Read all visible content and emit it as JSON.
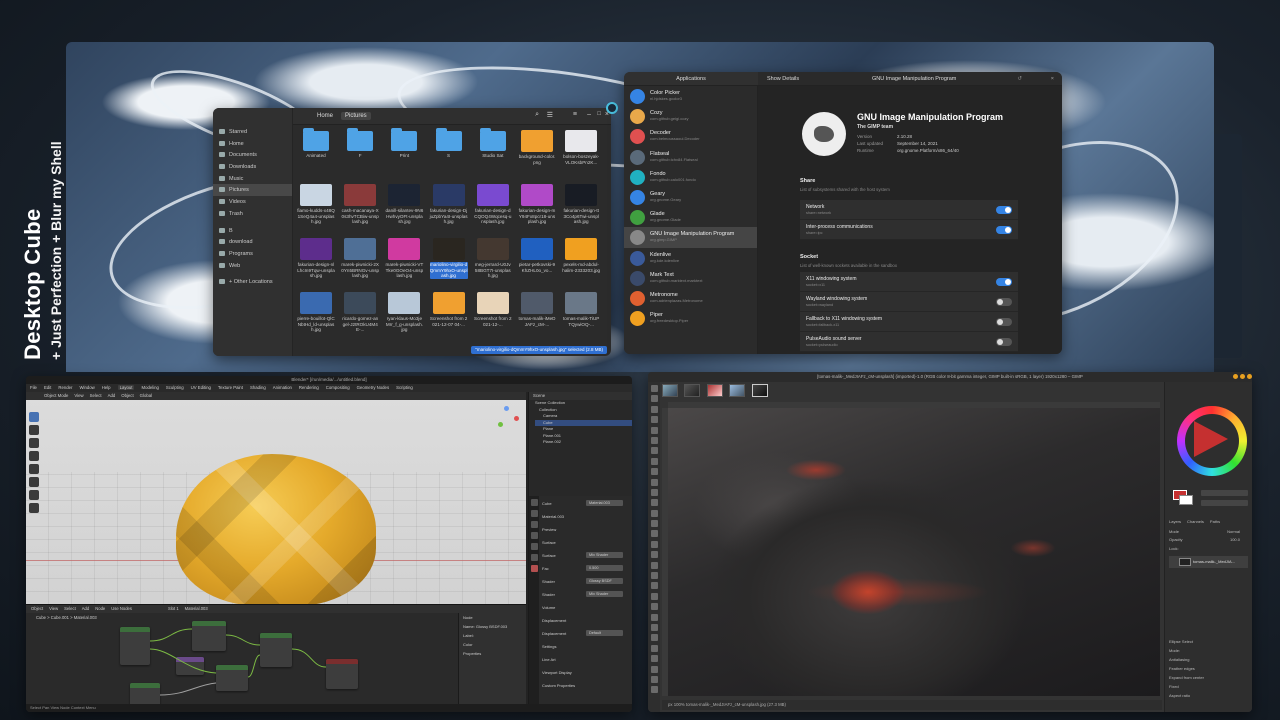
{
  "overlay": {
    "title": "Desktop Cube",
    "subtitle": "+ Just Perfection + Blur my Shell"
  },
  "files": {
    "sidebar": [
      {
        "label": "Starred",
        "active": false
      },
      {
        "label": "Home",
        "active": false
      },
      {
        "label": "Documents",
        "active": false
      },
      {
        "label": "Downloads",
        "active": false
      },
      {
        "label": "Music",
        "active": false
      },
      {
        "label": "Pictures",
        "active": true
      },
      {
        "label": "Videos",
        "active": false
      },
      {
        "label": "Trash",
        "active": false
      },
      {
        "label": "B",
        "active": false
      },
      {
        "label": "download",
        "active": false
      },
      {
        "label": "Programs",
        "active": false
      },
      {
        "label": "Web",
        "active": false
      },
      {
        "label": "+ Other Locations",
        "active": false
      }
    ],
    "path_home": "Home",
    "path_current": "Pictures",
    "items": [
      {
        "name": "Animated",
        "kind": "folder",
        "color": "#4fa3e6"
      },
      {
        "name": "F",
        "kind": "folder",
        "color": "#4fa3e6"
      },
      {
        "name": "Print",
        "kind": "folder",
        "color": "#4fa3e6"
      },
      {
        "name": "S",
        "kind": "folder",
        "color": "#4fa3e6"
      },
      {
        "name": "Studio Sat",
        "kind": "folder",
        "color": "#4fa3e6"
      },
      {
        "name": "background-color.png",
        "kind": "image",
        "color": "#f0a030"
      },
      {
        "name": "bolson-boszeyak-VLOKsbPn2K...",
        "kind": "image",
        "color": "#e8e8ec"
      },
      {
        "name": "fiamo-kudds-x48Q1SeQ4a4-unsplash.jpg",
        "kind": "image",
        "color": "#c9d6e3"
      },
      {
        "name": "cash-macanaya-X0s3hvTCBiw-unsplash.jpg",
        "kind": "image",
        "color": "#8a3a3a"
      },
      {
        "name": "danill-silantev-9N6HwhvyOFt-unsplash.jpg",
        "kind": "image",
        "color": "#1c2433"
      },
      {
        "name": "fakurian-design-DjjuZpbYa4I-unsplash.jpg",
        "kind": "image",
        "color": "#2a3a66"
      },
      {
        "name": "fakurian-design-dCQOQ4Wqcesq-unsplash.jpg",
        "kind": "image",
        "color": "#7a4ad0"
      },
      {
        "name": "fakurian-design-mY94Fx8pcr18-unsplash.jpg",
        "kind": "image",
        "color": "#b04ac8"
      },
      {
        "name": "fakurian-design-tt3Co4p6Twi-unsplash.jpg",
        "kind": "image",
        "color": "#181c24"
      },
      {
        "name": "fakurian-design-nlLhcIn9Tqw-unsplash.jpg",
        "kind": "image",
        "color": "#5d2d8c"
      },
      {
        "name": "marek-piwnicki-2X0Yn5BRNGv-unsplash.jpg",
        "kind": "image",
        "color": "#4f6f96"
      },
      {
        "name": "marek-piwnicki-VTTke0GOeO4-unsplash.jpg",
        "kind": "image",
        "color": "#d03aa0"
      },
      {
        "name": "mariolino-virgilio-dQmmY9hxO-unsplash.jpg",
        "kind": "image",
        "color": "#2a2620"
      },
      {
        "name": "meg-jerrard-U0Jv58BGT7I-unsplash.jpg",
        "kind": "image",
        "color": "#443830"
      },
      {
        "name": "pietar-petkovski-9KhZHL0o_vo...",
        "kind": "image",
        "color": "#2060c0"
      },
      {
        "name": "pexels-md-abdul-halim-2333203.jpg",
        "kind": "image",
        "color": "#f0a020"
      },
      {
        "name": "pierre-bouillot-QlCNbtHd_ld-unsplash.jpg",
        "kind": "image",
        "color": "#3a6ab0"
      },
      {
        "name": "ricardo-gomez-angel-J2tROkU4M4E-...",
        "kind": "image",
        "color": "#3c4a5a"
      },
      {
        "name": "ryan-klaus-Mo3jeMrr_f_g-unsplash.jpg",
        "kind": "image",
        "color": "#b8c8d8"
      },
      {
        "name": "Screenshot from 2021-12-07 04-...",
        "kind": "image",
        "color": "#f0a030"
      },
      {
        "name": "Screenshot from 2021-12-...",
        "kind": "image",
        "color": "#e8d4b8"
      },
      {
        "name": "tomas-malik-iMeDJAFz_cM-...",
        "kind": "image",
        "color": "#505a6a"
      },
      {
        "name": "tomas-malik-TiUPTQywiOQ-...",
        "kind": "image",
        "color": "#6a7888"
      }
    ],
    "selected_index": 17,
    "status": "\"mariolino-virgilio-dQmmY9hxO-unsplash.jpg\" selected (2.8 MB)"
  },
  "software": {
    "left_header": "Applications",
    "right_header": "Show Details",
    "center_header": "GNU Image Manipulation Program",
    "apps": [
      {
        "name": "Color Picker",
        "id": "nl.hjdskes.gcolor3",
        "color": "#3584e4"
      },
      {
        "name": "Cozy",
        "id": "com.github.geigi.cozy",
        "color": "#e8a84a"
      },
      {
        "name": "Decoder",
        "id": "com.belmoussaoui.Decoder",
        "color": "#e05050"
      },
      {
        "name": "Flatseal",
        "id": "com.github.tchx84.Flatseal",
        "color": "#5a6a7a"
      },
      {
        "name": "Fondo",
        "id": "com.github.calo001.fondo",
        "color": "#20b0c0"
      },
      {
        "name": "Geary",
        "id": "org.gnome.Geary",
        "color": "#3584e4"
      },
      {
        "name": "Glade",
        "id": "org.gnome.Glade",
        "color": "#40a040"
      },
      {
        "name": "GNU Image Manipulation Program",
        "id": "org.gimp.GIMP",
        "color": "#888888",
        "active": true
      },
      {
        "name": "Kdenlive",
        "id": "org.kde.kdenlive",
        "color": "#3a5a9a"
      },
      {
        "name": "Mark Text",
        "id": "com.github.marktext.marktext",
        "color": "#3a4a6a"
      },
      {
        "name": "Metronome",
        "id": "com.adrienplazas.Metronome",
        "color": "#e06030"
      },
      {
        "name": "Piper",
        "id": "org.freedesktop.Piper",
        "color": "#f0a020"
      }
    ],
    "detail": {
      "name": "GNU Image Manipulation Program",
      "team": "The GIMP team",
      "version_label": "Version",
      "version": "2.10.28",
      "updated_label": "Last updated",
      "updated": "September 14, 2021",
      "runtime_label": "Runtime",
      "runtime": "org.gnome.Platform/x86_64/40",
      "share_title": "Share",
      "share_desc": "List of subsystems shared with the host system",
      "socket_title": "Socket",
      "socket_desc": "List of well-known sockets available in the sandbox",
      "permissions": [
        {
          "name": "Network",
          "desc": "share=network",
          "on": true,
          "group": "share"
        },
        {
          "name": "Inter-process communications",
          "desc": "share=ipc",
          "on": true,
          "group": "share"
        },
        {
          "name": "X11 windowing system",
          "desc": "socket=x11",
          "on": true,
          "group": "socket"
        },
        {
          "name": "Wayland windowing system",
          "desc": "socket=wayland",
          "on": false,
          "group": "socket"
        },
        {
          "name": "Fallback to X11 windowing system",
          "desc": "socket=fallback-x11",
          "on": false,
          "group": "socket"
        },
        {
          "name": "PulseAudio sound server",
          "desc": "socket=pulseaudio",
          "on": false,
          "group": "socket"
        }
      ]
    }
  },
  "blender": {
    "title": "Blender* [/run/media/.../untitled.blend]",
    "menu": [
      "File",
      "Edit",
      "Render",
      "Window",
      "Help",
      "Layout",
      "Modeling",
      "Sculpting",
      "UV Editing",
      "Texture Paint",
      "Shading",
      "Animation",
      "Rendering",
      "Compositing",
      "Geometry Nodes",
      "Scripting"
    ],
    "active_workspace": "Layout",
    "viewport_header": [
      "Object Mode",
      "View",
      "Select",
      "Add",
      "Object",
      "Global"
    ],
    "outliner_header": "Scene",
    "outliner": [
      {
        "label": "Scene Collection",
        "sel": false
      },
      {
        "label": "Collection",
        "sel": false
      },
      {
        "label": "Camera",
        "sel": false
      },
      {
        "label": "Cube",
        "sel": true
      },
      {
        "label": "Plane",
        "sel": false
      },
      {
        "label": "Plane.001",
        "sel": false
      },
      {
        "label": "Plane.002",
        "sel": false
      }
    ],
    "props": [
      {
        "label": "Cube",
        "value": "Material.003"
      },
      {
        "label": "Material.003",
        "value": ""
      },
      {
        "label": "Preview",
        "value": ""
      },
      {
        "label": "Surface",
        "value": ""
      },
      {
        "label": "Surface",
        "value": "Mix Shader"
      },
      {
        "label": "Fac",
        "value": "0.500"
      },
      {
        "label": "Shader",
        "value": "Glossy BSDF"
      },
      {
        "label": "Shader",
        "value": "Mix Shader"
      },
      {
        "label": "Volume",
        "value": ""
      },
      {
        "label": "Displacement",
        "value": ""
      },
      {
        "label": "Displacement",
        "value": "Default"
      },
      {
        "label": "Settings",
        "value": ""
      },
      {
        "label": "Line Art",
        "value": ""
      },
      {
        "label": "Viewport Display",
        "value": ""
      },
      {
        "label": "Custom Properties",
        "value": ""
      }
    ],
    "node_header": [
      "Object",
      "View",
      "Select",
      "Add",
      "Node",
      "Use Nodes"
    ],
    "node_slot": "Slot 1",
    "node_material": "Material.003",
    "node_crumb": "Cube  >  Cube.001  >  Material.003",
    "node_panel": [
      "Node",
      "Name: Glossy BSDF.003",
      "Label:",
      "Color",
      "Properties"
    ],
    "status": "Select  Pan View  Node  Context Menu"
  },
  "gimp": {
    "title": "[tomas-malik-_MedJIAFz_cM-unsplash] (imported)-1.0 (RGB color 8-bit gamma integer, GIMP built-in sRGB, 1 layer) 1920x1280 – GIMP",
    "status": "px  100%  tomas-malik-_MedJIAFz_cM-unsplash.jpg (27.3 MB)",
    "fg_color": "#c53030",
    "layers_tabs": [
      "Layers",
      "Channels",
      "Paths"
    ],
    "mode_label": "Mode",
    "mode_value": "Normal",
    "opacity_label": "Opacity",
    "opacity_value": "100.0",
    "lock_label": "Lock:",
    "layer_name": "tomas-malik-_MedJIA...",
    "tool_options": [
      "Ellipse Select",
      "Mode:",
      "Antialiasing",
      "Feather edges",
      "Expand from center",
      "Fixed",
      "Aspect ratio"
    ]
  }
}
